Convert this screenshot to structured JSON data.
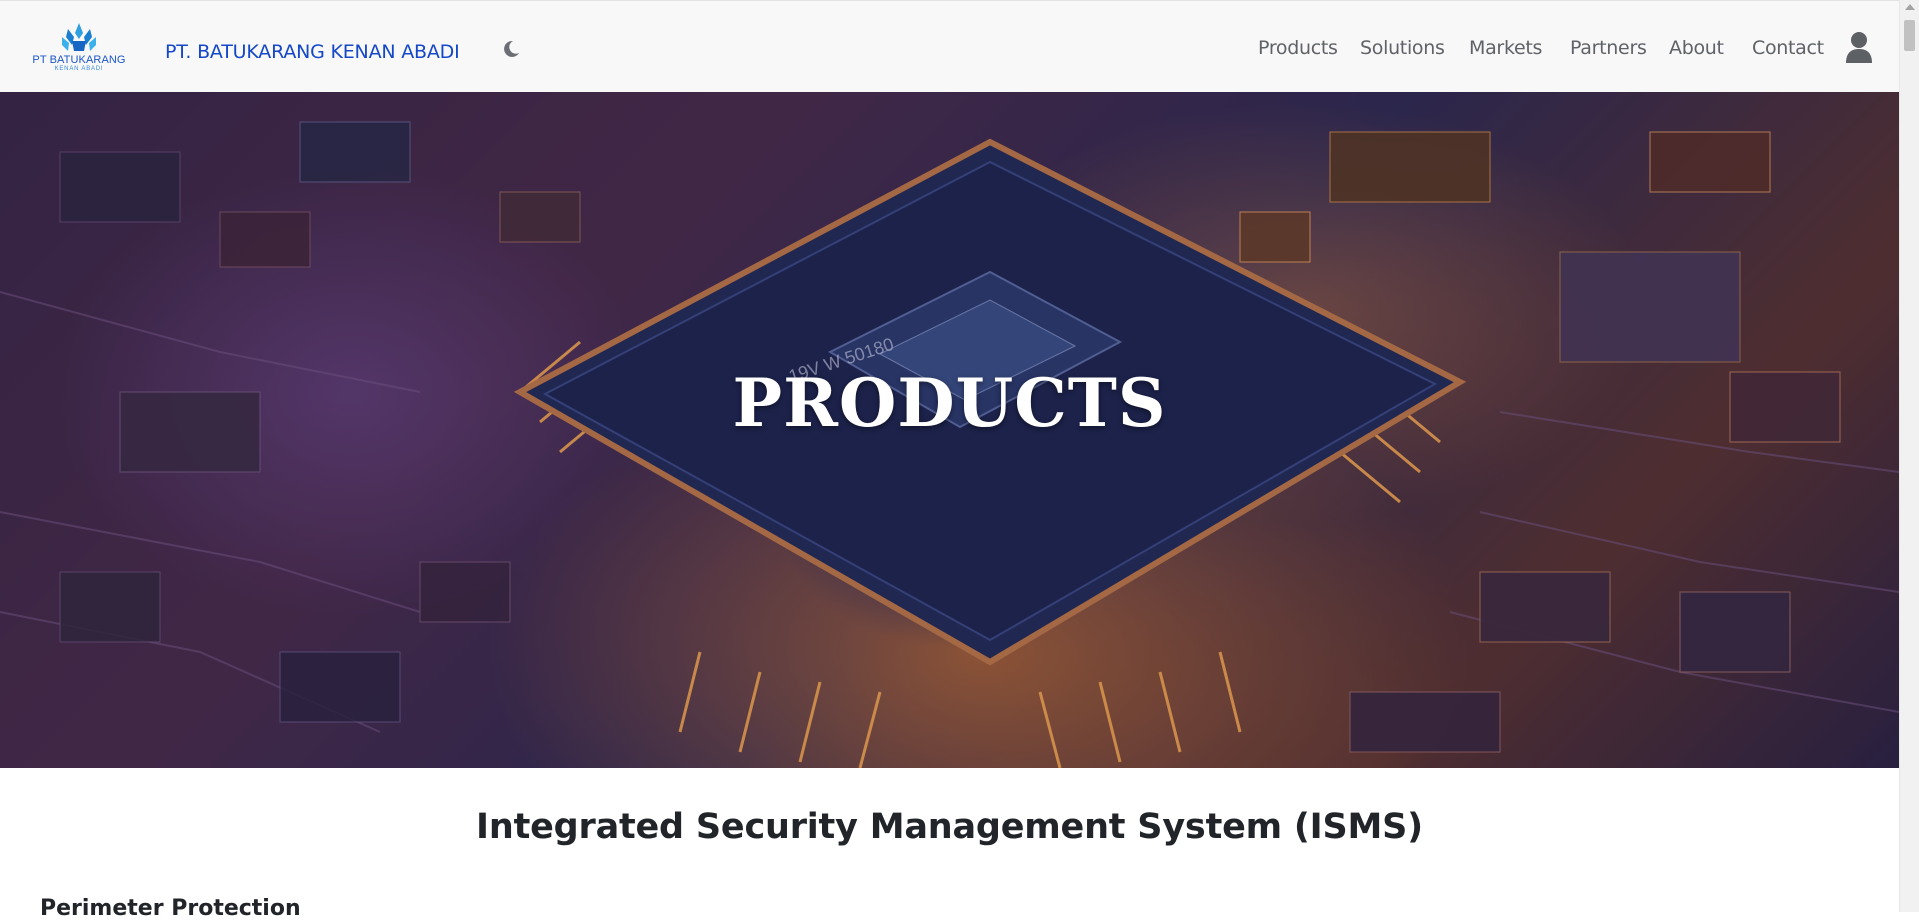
{
  "header": {
    "logo": {
      "title": "PT BATUKARANG",
      "subtitle": "KENAN ABADI"
    },
    "company_name": "PT. BATUKARANG KENAN ABADI",
    "theme_toggle_icon": "moon-icon",
    "nav": [
      {
        "label": "Products"
      },
      {
        "label": "Solutions"
      },
      {
        "label": "Markets"
      },
      {
        "label": "Partners"
      },
      {
        "label": "About"
      },
      {
        "label": "Contact"
      }
    ],
    "user_icon": "user-icon"
  },
  "hero": {
    "title": "PRODUCTS",
    "chip_marking": "19V W 50180"
  },
  "main": {
    "section_title": "Integrated Security Management System (ISMS)",
    "sub_heading": "Perimeter Protection"
  },
  "colors": {
    "brand_blue": "#1448c8",
    "nav_text": "#5f6266",
    "header_bg": "#f8f8f9",
    "heading_text": "#212529"
  }
}
